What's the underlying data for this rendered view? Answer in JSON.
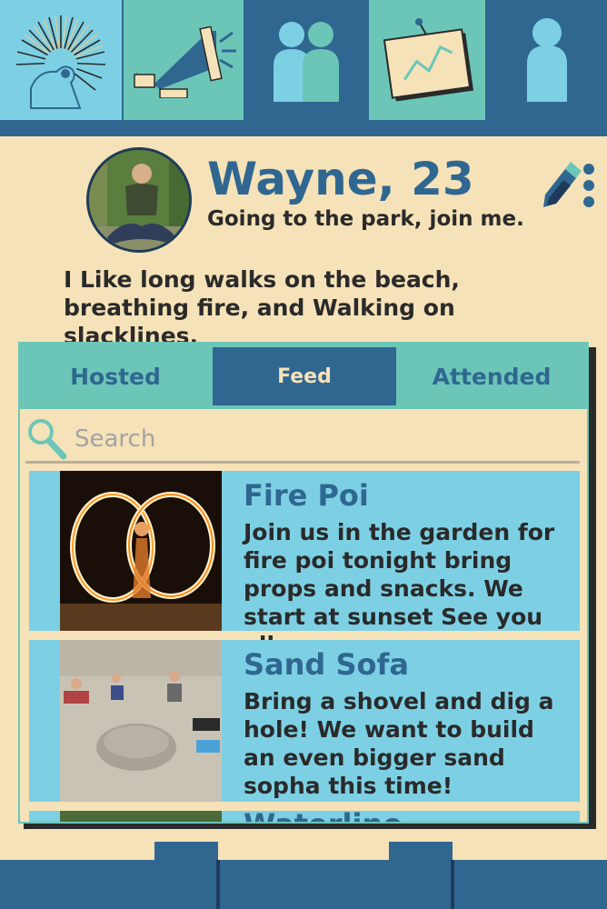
{
  "nav": {
    "items": [
      {
        "name": "nav-discover",
        "icon": "radial-burst-icon"
      },
      {
        "name": "nav-announce",
        "icon": "megaphone-icon"
      },
      {
        "name": "nav-friends",
        "icon": "people-icon"
      },
      {
        "name": "nav-activity",
        "icon": "chart-board-icon"
      },
      {
        "name": "nav-profile",
        "icon": "person-icon"
      }
    ]
  },
  "profile": {
    "name": "Wayne, 23",
    "status": "Going to the park, join me.",
    "bio": "I Like long walks on the beach, breathing fire, and Walking on slacklines."
  },
  "tabs": [
    {
      "label": "Hosted"
    },
    {
      "label": "Feed",
      "active": true
    },
    {
      "label": "Attended"
    }
  ],
  "search": {
    "placeholder": "Search"
  },
  "feed": [
    {
      "title": "Fire Poi",
      "description": "Join us in the garden for fire poi tonight bring props and snacks. We start at sunset See you all"
    },
    {
      "title": "Sand Sofa",
      "description": "Bring a shovel and dig a hole! We want to build an even bigger sand sopha this time!"
    },
    {
      "title": "Waterline",
      "description": ""
    }
  ],
  "colors": {
    "accent": "#2f6791",
    "teal": "#6cc6b8",
    "card": "#7dd0e4",
    "background": "#f6e2b8"
  }
}
